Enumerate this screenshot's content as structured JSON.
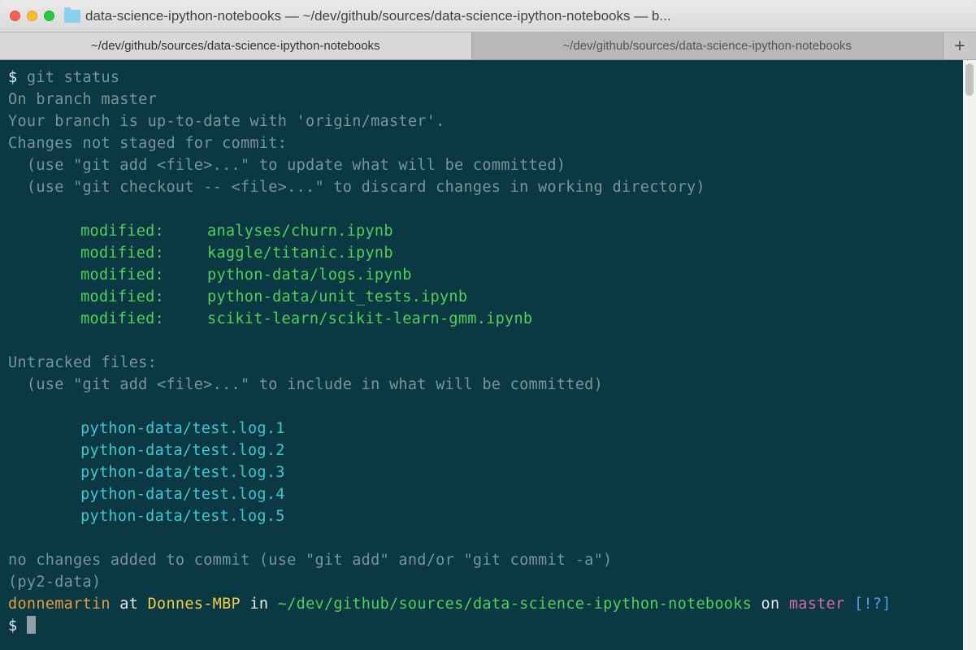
{
  "window": {
    "title": "data-science-ipython-notebooks — ~/dev/github/sources/data-science-ipython-notebooks — b..."
  },
  "tabs": {
    "tab1": "~/dev/github/sources/data-science-ipython-notebooks",
    "tab2": "~/dev/github/sources/data-science-ipython-notebooks",
    "new_tab": "+"
  },
  "terminal": {
    "prompt1_symbol": "$ ",
    "prompt1_cmd": "git status",
    "branch_line": "On branch master",
    "uptodate_line": "Your branch is up-to-date with 'origin/master'.",
    "not_staged_line": "Changes not staged for commit:",
    "hint_add": "  (use \"git add <file>...\" to update what will be committed)",
    "hint_checkout": "  (use \"git checkout -- <file>...\" to discard changes in working directory)",
    "mod_label": "modified:",
    "modified": [
      "analyses/churn.ipynb",
      "kaggle/titanic.ipynb",
      "python-data/logs.ipynb",
      "python-data/unit_tests.ipynb",
      "scikit-learn/scikit-learn-gmm.ipynb"
    ],
    "untracked_header": "Untracked files:",
    "hint_untracked": "  (use \"git add <file>...\" to include in what will be committed)",
    "untracked": [
      "python-data/test.log.1",
      "python-data/test.log.2",
      "python-data/test.log.3",
      "python-data/test.log.4",
      "python-data/test.log.5"
    ],
    "no_changes": "no changes added to commit (use \"git add\" and/or \"git commit -a\")",
    "venv": "(py2-data)",
    "ps1": {
      "user": "donnemartin",
      "at": " at ",
      "host": "Donnes-MBP",
      "in": " in ",
      "path": "~/dev/github/sources/data-science-ipython-notebooks",
      "on": " on ",
      "branch": "master",
      "status": " [!?]"
    },
    "prompt2_symbol": "$ "
  }
}
